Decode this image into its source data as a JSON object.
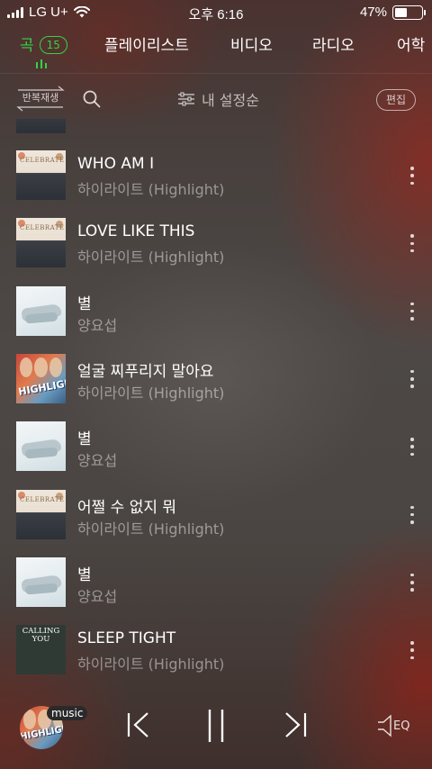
{
  "status_bar": {
    "carrier": "LG U+",
    "time": "오후 6:16",
    "battery_percent": "47%",
    "battery_level": 0.47
  },
  "tabs": [
    {
      "label": "곡",
      "count": "15",
      "active": true
    },
    {
      "label": "플레이리스트"
    },
    {
      "label": "비디오"
    },
    {
      "label": "라디오"
    },
    {
      "label": "어학"
    }
  ],
  "toolbar": {
    "repeat_label": "반복재생",
    "sort_label": "내 설정순",
    "edit_label": "편집"
  },
  "songs": [
    {
      "title": "WHO AM I",
      "artist": "하이라이트 (Highlight)",
      "art": "celebrate"
    },
    {
      "title": "LOVE LIKE THIS",
      "artist": "하이라이트 (Highlight)",
      "art": "celebrate"
    },
    {
      "title": "별",
      "artist": "양요섭",
      "art": "star"
    },
    {
      "title": "얼굴 찌푸리지 말아요",
      "artist": "하이라이트 (Highlight)",
      "art": "highlight"
    },
    {
      "title": "별",
      "artist": "양요섭",
      "art": "star"
    },
    {
      "title": "어쩔 수 없지 뭐",
      "artist": "하이라이트 (Highlight)",
      "art": "celebrate"
    },
    {
      "title": "별",
      "artist": "양요섭",
      "art": "star"
    },
    {
      "title": "SLEEP TIGHT",
      "artist": "하이라이트 (Highlight)",
      "art": "calling"
    }
  ],
  "album_art_text": {
    "celebrate": "CELEBRATE",
    "highlight": "HIGHLIGHT",
    "calling": "CALLING YOU"
  },
  "player": {
    "badge": "music",
    "eq_label": "EQ"
  },
  "colors": {
    "accent": "#35d049"
  }
}
